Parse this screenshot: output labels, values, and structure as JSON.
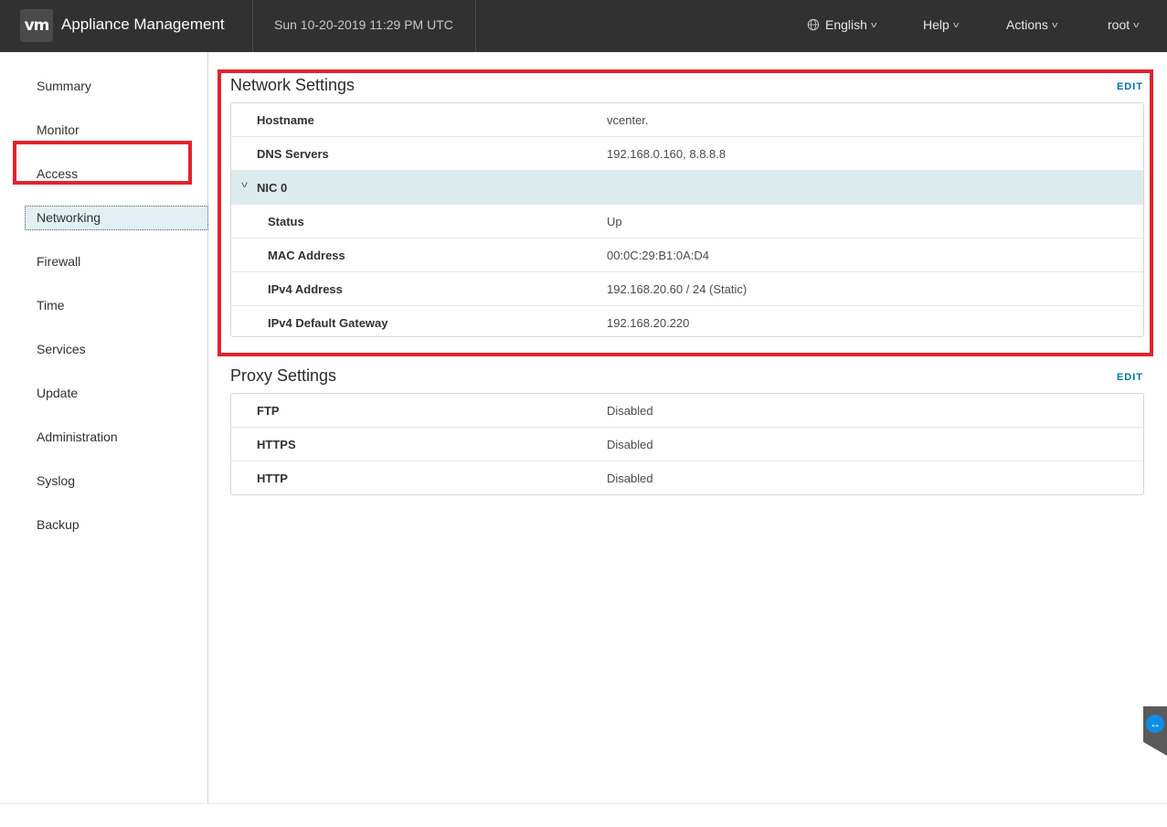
{
  "header": {
    "logo": "vm",
    "app_title": "Appliance Management",
    "datetime": "Sun 10-20-2019 11:29 PM UTC",
    "language": "English",
    "help": "Help",
    "actions": "Actions",
    "user": "root"
  },
  "sidebar": {
    "items": [
      {
        "label": "Summary"
      },
      {
        "label": "Monitor"
      },
      {
        "label": "Access"
      },
      {
        "label": "Networking"
      },
      {
        "label": "Firewall"
      },
      {
        "label": "Time"
      },
      {
        "label": "Services"
      },
      {
        "label": "Update"
      },
      {
        "label": "Administration"
      },
      {
        "label": "Syslog"
      },
      {
        "label": "Backup"
      }
    ],
    "active": "Networking"
  },
  "network": {
    "title": "Network Settings",
    "edit": "EDIT",
    "rows": [
      {
        "key": "Hostname",
        "value": "vcenter."
      },
      {
        "key": "DNS Servers",
        "value": "192.168.0.160, 8.8.8.8"
      }
    ],
    "nic": {
      "label": "NIC 0",
      "rows": [
        {
          "key": "Status",
          "value": "Up"
        },
        {
          "key": "MAC Address",
          "value": "00:0C:29:B1:0A:D4"
        },
        {
          "key": "IPv4 Address",
          "value": "192.168.20.60 / 24 (Static)"
        },
        {
          "key": "IPv4 Default Gateway",
          "value": "192.168.20.220"
        }
      ]
    }
  },
  "proxy": {
    "title": "Proxy Settings",
    "edit": "EDIT",
    "rows": [
      {
        "key": "FTP",
        "value": "Disabled"
      },
      {
        "key": "HTTPS",
        "value": "Disabled"
      },
      {
        "key": "HTTP",
        "value": "Disabled"
      }
    ]
  },
  "colors": {
    "header_bg": "#313131",
    "highlight": "#e0242c",
    "link": "#0072a3",
    "group_row_bg": "#ddecee"
  }
}
